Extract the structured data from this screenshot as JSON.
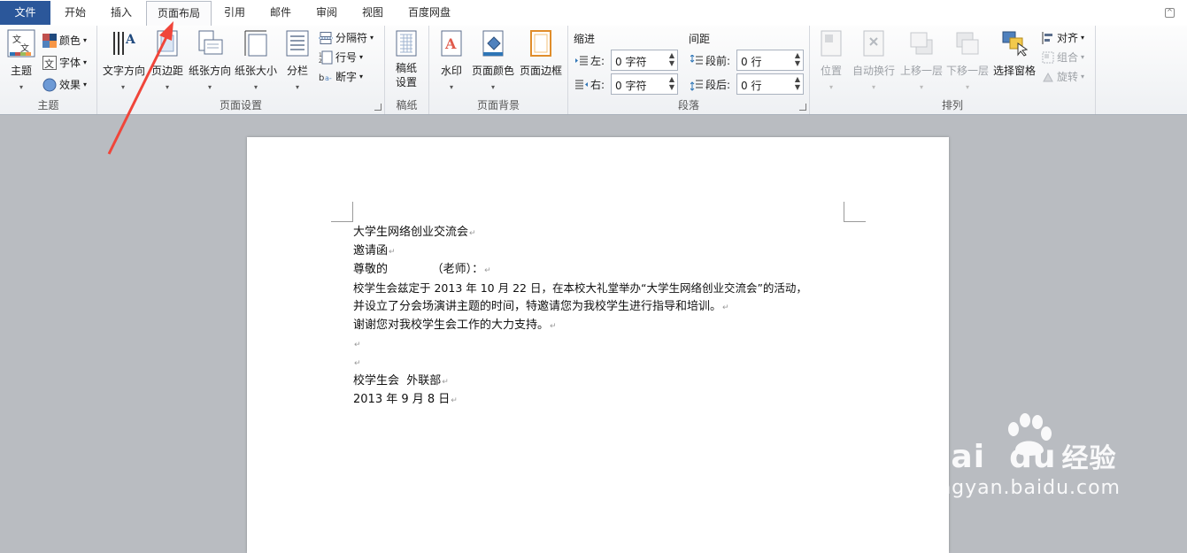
{
  "tabs": [
    "文件",
    "开始",
    "插入",
    "页面布局",
    "引用",
    "邮件",
    "审阅",
    "视图",
    "百度网盘"
  ],
  "active_tab": "页面布局",
  "groups": {
    "theme": {
      "label": "主题",
      "big": "主题",
      "colors": "颜色",
      "fonts": "字体",
      "effects": "效果"
    },
    "page_setup": {
      "label": "页面设置",
      "text_direction": "文字方向",
      "margins": "页边距",
      "orientation": "纸张方向",
      "size": "纸张大小",
      "columns": "分栏",
      "breaks": "分隔符",
      "line_numbers": "行号",
      "hyphenation": "断字"
    },
    "manuscript": {
      "label": "稿纸",
      "btn_line1": "稿纸",
      "btn_line2": "设置"
    },
    "page_background": {
      "label": "页面背景",
      "watermark": "水印",
      "page_color": "页面颜色",
      "page_borders": "页面边框"
    },
    "paragraph": {
      "label": "段落",
      "indent_title": "缩进",
      "left_label": "左:",
      "left_value": "0 字符",
      "right_label": "右:",
      "right_value": "0 字符",
      "spacing_title": "间距",
      "before_label": "段前:",
      "before_value": "0 行",
      "after_label": "段后:",
      "after_value": "0 行"
    },
    "arrange": {
      "label": "排列",
      "position": "位置",
      "wrap": "自动换行",
      "forward": "上移一层",
      "backward": "下移一层",
      "selection": "选择窗格",
      "align": "对齐",
      "group": "组合",
      "rotate": "旋转"
    }
  },
  "document": {
    "lines": [
      "大学生网络创业交流会",
      "邀请函",
      "尊敬的            （老师）：",
      "校学生会兹定于 2013 年 10 月 22 日，在本校大礼堂举办“大学生网络创业交流会”的活动，",
      "并设立了分会场演讲主题的时间，特邀请您为我校学生进行指导和培训。",
      "谢谢您对我校学生会工作的大力支持。",
      "",
      "",
      "校学生会  外联部",
      "2013 年 9 月 8 日"
    ],
    "paragraph_mark": "↵"
  },
  "watermark": {
    "brand": "Bai  du",
    "brand_cn": "经验",
    "url": "jingyan.baidu.com"
  },
  "colors": {
    "file_tab": "#2b579a",
    "arrow": "#f0453a",
    "workspace": "#b9bcc1"
  }
}
